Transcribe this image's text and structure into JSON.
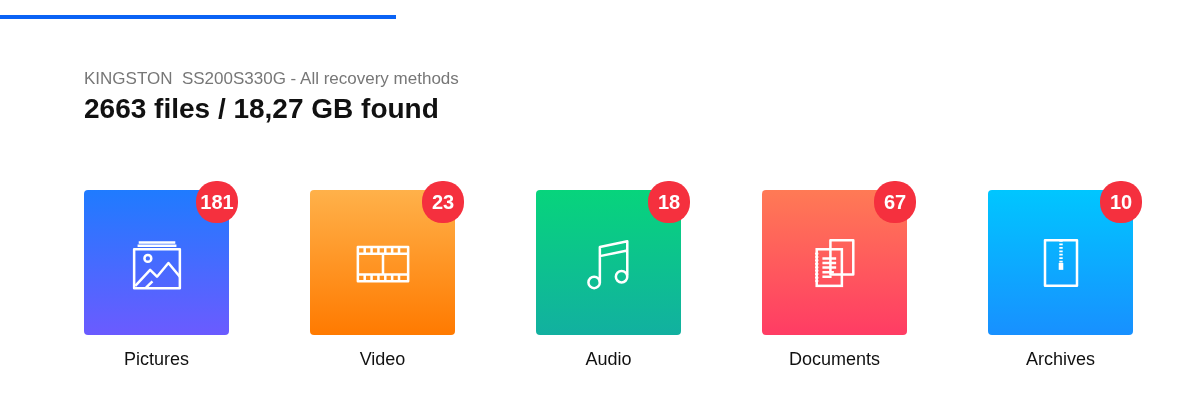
{
  "scan_progress": {
    "level": 0.33
  },
  "drive": "KINGSTON  SS200S330G - All recovery methods",
  "summary": "2663 files / 18,27 GB found",
  "categories": [
    {
      "kind": "pictures",
      "label": "Pictures",
      "count": "181"
    },
    {
      "kind": "video",
      "label": "Video",
      "count": "23"
    },
    {
      "kind": "audio",
      "label": "Audio",
      "count": "18"
    },
    {
      "kind": "documents",
      "label": "Documents",
      "count": "67"
    },
    {
      "kind": "archives",
      "label": "Archives",
      "count": "10"
    }
  ]
}
